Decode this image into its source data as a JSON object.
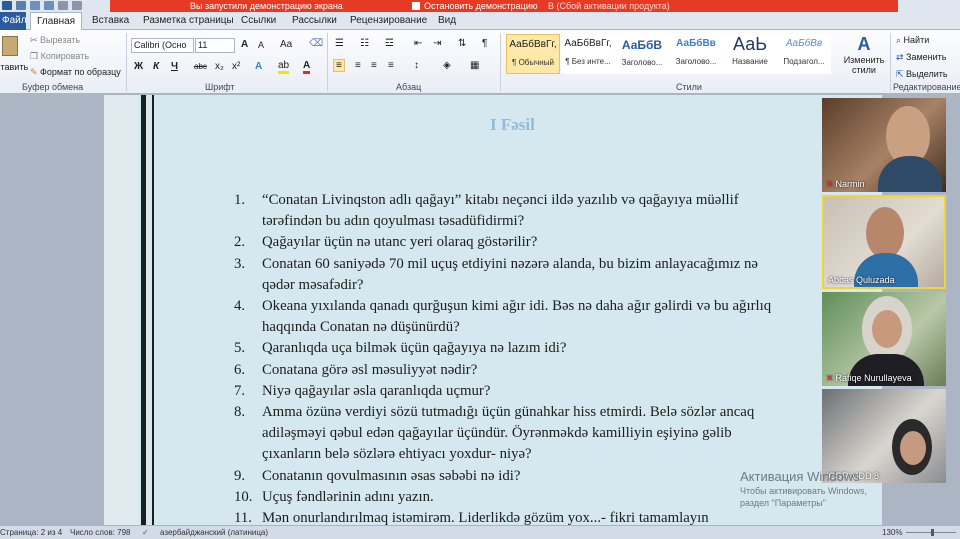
{
  "banner": {
    "demo_text": "Вы запустили демонстрацию экрана",
    "stop_text": "Остановить демонстрацию",
    "activation_hint": "В (Сбой активации продукта)"
  },
  "tabs": [
    {
      "label": "Файл"
    },
    {
      "label": "Главная"
    },
    {
      "label": "Вставка"
    },
    {
      "label": "Разметка страницы"
    },
    {
      "label": "Ссылки"
    },
    {
      "label": "Рассылки"
    },
    {
      "label": "Рецензирование"
    },
    {
      "label": "Вид"
    }
  ],
  "clipboard": {
    "paste": "Вставить",
    "cut": "Вырезать",
    "copy": "Копировать",
    "format_painter": "Формат по образцу",
    "group": "Буфер обмена"
  },
  "font": {
    "name": "Calibri (Осно",
    "size": "11",
    "group": "Шрифт",
    "grow": "A",
    "shrink": "A",
    "case": "Aa",
    "bold": "Ж",
    "italic": "К",
    "underline": "Ч",
    "strike": "abc",
    "subscript": "x₂",
    "superscript": "x²"
  },
  "paragraph": {
    "group": "Абзац"
  },
  "styles": {
    "group": "Стили",
    "items": [
      {
        "sample": "АаБбВвГг,",
        "label": "¶ Обычный"
      },
      {
        "sample": "АаБбВвГг,",
        "label": "¶ Без инте..."
      },
      {
        "sample": "АаБбВ",
        "label": "Заголово..."
      },
      {
        "sample": "АаБбВв",
        "label": "Заголово..."
      },
      {
        "sample": "АаЬ",
        "label": "Название"
      },
      {
        "sample": "АаБбВв",
        "label": "Подзагол..."
      }
    ],
    "change": "Изменить стили"
  },
  "editing": {
    "group": "Редактирование",
    "find": "Найти",
    "replace": "Заменить",
    "select": "Выделить"
  },
  "document": {
    "title": "I Fəsil",
    "questions": [
      {
        "num": "1.",
        "text": "“Conatan Livinqston adlı qağayı” kitabı neçənci ildə yazılıb və qağayıya müəllif tərəfindən bu adın qoyulması təsadüfidirmi?"
      },
      {
        "num": "2.",
        "text": "Qağayılar üçün nə utanc yeri olaraq göstərilir?"
      },
      {
        "num": "3.",
        "text": "Conatan 60 saniyədə 70 mil uçuş etdiyini nəzərə alanda, bu bizim anlayacağımız nə qədər məsafədir?"
      },
      {
        "num": "4.",
        "text": "Okeana yıxılanda qanadı qurğuşun kimi ağır idi. Bəs nə daha ağır gəlirdi və bu ağırlıq haqqında Conatan nə düşünürdü?"
      },
      {
        "num": "5.",
        "text": "Qaranlıqda uça bilmək üçün qağayıya nə lazım idi?"
      },
      {
        "num": "6.",
        "text": "Conatana görə əsl məsuliyyət nədir?"
      },
      {
        "num": "7.",
        "text": "Niyə qağayılar əsla qaranlıqda uçmur?"
      },
      {
        "num": "8.",
        "text": "Amma özünə verdiyi sözü tutmadığı üçün günahkar hiss etmirdi. Belə sözlər ancaq adiləşməyi qəbul edən qağayılar üçündür. Öyrənməkdə kamilliyin eşiyinə gəlib çıxanların belə sözlərə ehtiyacı yoxdur- niyə?"
      },
      {
        "num": "9.",
        "text": "Conatanın qovulmasının əsas səbəbi nə idi?"
      },
      {
        "num": "10.",
        "text": "Uçuş fəndlərinin adını yazın."
      },
      {
        "num": "11.",
        "text": "Mən onurlandırılmaq istəmirəm. Liderlikdə gözüm yox...- fikri tamamlayın"
      }
    ]
  },
  "participants": [
    {
      "name": "Narmin",
      "muted": true
    },
    {
      "name": "Abbas Quluzada",
      "muted": false
    },
    {
      "name": "Rafiqe Nurullayeva",
      "muted": true
    },
    {
      "name": "ICGR MDD 8",
      "muted": false
    }
  ],
  "watermark": {
    "line1": "Активация Windows",
    "line2": "Чтобы активировать Windows,",
    "line3": "раздел \"Параметры\""
  },
  "status": {
    "page": "Страница: 2 из 4",
    "words": "Число слов: 798",
    "language": "азербайджанский (латиница)",
    "zoom": "130%"
  }
}
